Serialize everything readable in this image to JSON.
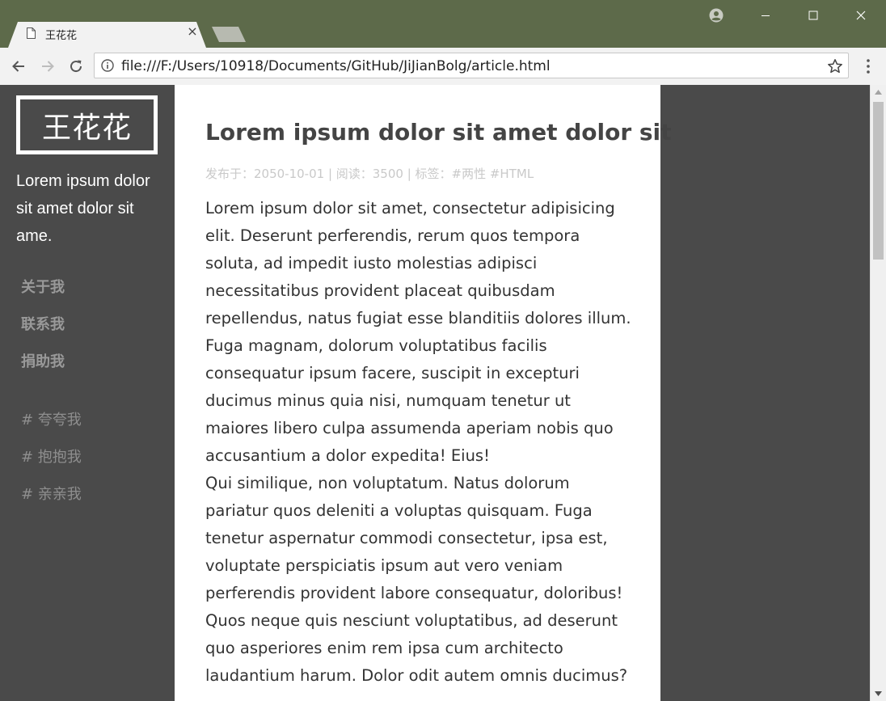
{
  "browser": {
    "tab_title": "王花花",
    "tab_close": "×",
    "url": "file:///F:/Users/10918/Documents/GitHub/JiJianBolg/article.html"
  },
  "sidebar": {
    "logo": "王花花",
    "tagline": "Lorem ipsum dolor sit amet dolor sit ame.",
    "nav": [
      {
        "label": "关于我"
      },
      {
        "label": "联系我"
      },
      {
        "label": "捐助我"
      }
    ],
    "tags": [
      {
        "label": "# 夸夸我"
      },
      {
        "label": "# 抱抱我"
      },
      {
        "label": "# 亲亲我"
      }
    ]
  },
  "article": {
    "title": "Lorem ipsum dolor sit amet dolor sit",
    "meta": "发布于：2050-10-01 | 阅读：3500 | 标签：#两性 #HTML",
    "paragraphs": [
      "Lorem ipsum dolor sit amet, consectetur adipisicing elit. Deserunt perferendis, rerum quos tempora soluta, ad impedit iusto molestias adipisci necessitatibus provident placeat quibusdam repellendus, natus fugiat esse blanditiis dolores illum.",
      "Fuga magnam, dolorum voluptatibus facilis consequatur ipsum facere, suscipit in excepturi ducimus minus quia nisi, numquam tenetur ut maiores libero culpa assumenda aperiam nobis quo accusantium a dolor expedita! Eius!",
      "Qui similique, non voluptatum. Natus dolorum pariatur quos deleniti a voluptas quisquam. Fuga tenetur aspernatur commodi consectetur, ipsa est, voluptate perspiciatis ipsum aut vero veniam perferendis provident labore consequatur, doloribus!",
      "Quos neque quis nesciunt voluptatibus, ad deserunt quo asperiores enim rem ipsa cum architecto laudantium harum. Dolor odit autem omnis ducimus?"
    ]
  },
  "colors": {
    "titlebar": "#5d6a4a",
    "sidebar_bg": "#4a4a4a",
    "article_bg": "#ffffff",
    "nav_text": "#999999",
    "meta_text": "#c9c9c9"
  },
  "icons": {
    "back": "arrow-left-icon",
    "forward": "arrow-right-icon",
    "reload": "reload-icon",
    "info": "info-icon",
    "bookmark": "star-icon",
    "menu": "more-vertical-icon",
    "profile": "account-icon",
    "document": "document-icon"
  }
}
